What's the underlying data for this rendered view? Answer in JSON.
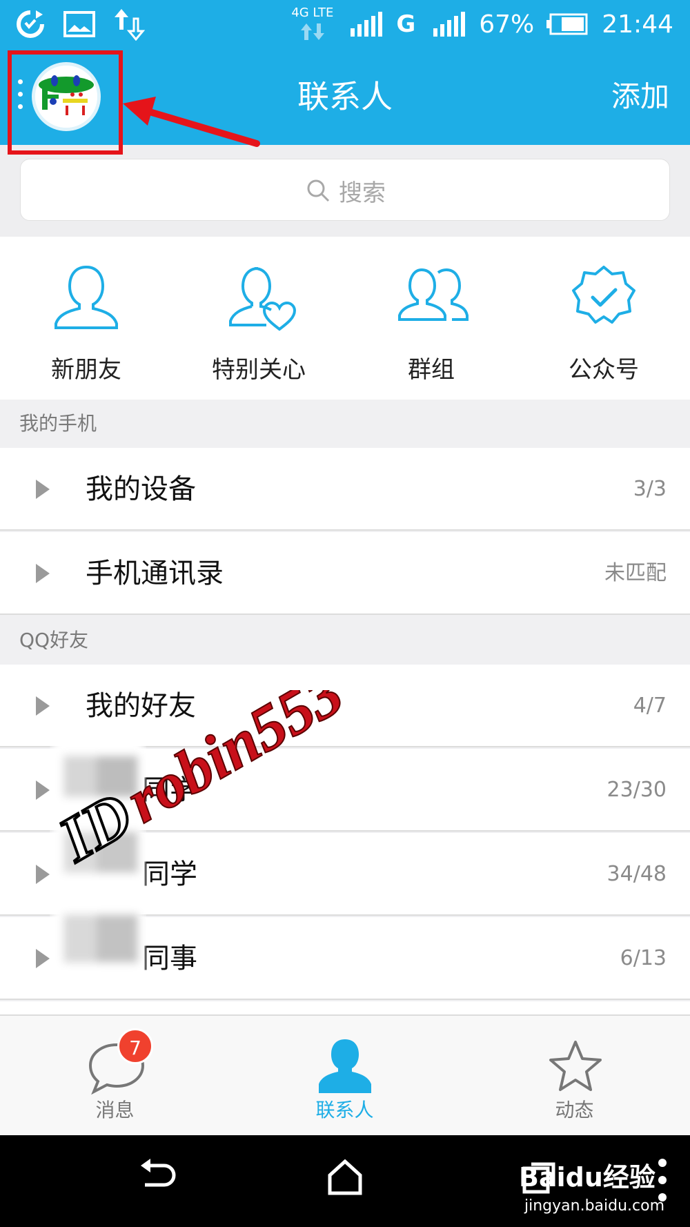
{
  "status_bar": {
    "network_label": "4G LTE",
    "carrier_label": "G",
    "battery": "67%",
    "time": "21:44"
  },
  "header": {
    "title": "联系人",
    "add_label": "添加"
  },
  "search": {
    "placeholder": "搜索"
  },
  "shortcuts": [
    {
      "label": "新朋友",
      "icon": "new-friend-icon"
    },
    {
      "label": "特别关心",
      "icon": "special-care-icon"
    },
    {
      "label": "群组",
      "icon": "group-icon"
    },
    {
      "label": "公众号",
      "icon": "official-account-icon"
    }
  ],
  "sections": [
    {
      "title": "我的手机"
    },
    {
      "title": "QQ好友"
    }
  ],
  "rows": [
    {
      "name": "我的设备",
      "count": "3/3"
    },
    {
      "name": "手机通讯录",
      "count": "未匹配"
    },
    {
      "name": "我的好友",
      "count": "4/7"
    },
    {
      "name": "同学",
      "count": "23/30"
    },
    {
      "name": "同学",
      "count": "34/48"
    },
    {
      "name": "同事",
      "count": "6/13"
    }
  ],
  "watermark": "ID robin553",
  "tabbar": {
    "messages_label": "消息",
    "messages_badge": "7",
    "contacts_label": "联系人",
    "feed_label": "动态"
  },
  "nav_watermark": {
    "logo": "Baidu经验",
    "url": "jingyan.baidu.com"
  },
  "colors": {
    "accent": "#1eaee6",
    "badge": "#f0412e",
    "highlight": "#e5141a"
  }
}
